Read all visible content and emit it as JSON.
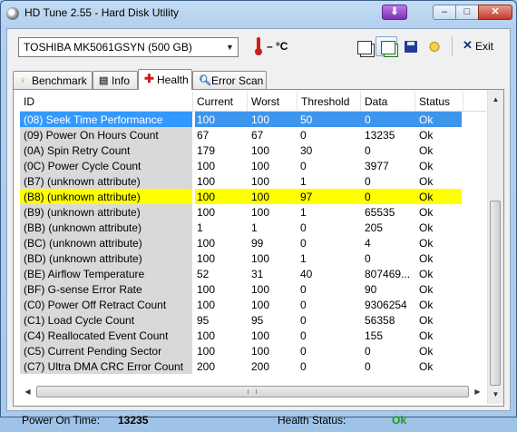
{
  "window": {
    "title": "HD Tune 2.55 - Hard Disk Utility"
  },
  "toolbar": {
    "drive": "TOSHIBA MK5061GSYN (500 GB)",
    "temperature": "– °C",
    "exit_label": "Exit"
  },
  "tabs": [
    {
      "label": "Benchmark"
    },
    {
      "label": "Info"
    },
    {
      "label": "Health"
    },
    {
      "label": "Error Scan"
    }
  ],
  "table": {
    "columns": [
      "ID",
      "Current",
      "Worst",
      "Threshold",
      "Data",
      "Status"
    ],
    "rows": [
      {
        "id": "(08) Seek Time Performance",
        "current": "100",
        "worst": "100",
        "threshold": "50",
        "data": "0",
        "status": "Ok"
      },
      {
        "id": "(09) Power On Hours Count",
        "current": "67",
        "worst": "67",
        "threshold": "0",
        "data": "13235",
        "status": "Ok"
      },
      {
        "id": "(0A) Spin Retry Count",
        "current": "179",
        "worst": "100",
        "threshold": "30",
        "data": "0",
        "status": "Ok"
      },
      {
        "id": "(0C) Power Cycle Count",
        "current": "100",
        "worst": "100",
        "threshold": "0",
        "data": "3977",
        "status": "Ok"
      },
      {
        "id": "(B7) (unknown attribute)",
        "current": "100",
        "worst": "100",
        "threshold": "1",
        "data": "0",
        "status": "Ok"
      },
      {
        "id": "(B8) (unknown attribute)",
        "current": "100",
        "worst": "100",
        "threshold": "97",
        "data": "0",
        "status": "Ok"
      },
      {
        "id": "(B9) (unknown attribute)",
        "current": "100",
        "worst": "100",
        "threshold": "1",
        "data": "65535",
        "status": "Ok"
      },
      {
        "id": "(BB) (unknown attribute)",
        "current": "1",
        "worst": "1",
        "threshold": "0",
        "data": "205",
        "status": "Ok"
      },
      {
        "id": "(BC) (unknown attribute)",
        "current": "100",
        "worst": "99",
        "threshold": "0",
        "data": "4",
        "status": "Ok"
      },
      {
        "id": "(BD) (unknown attribute)",
        "current": "100",
        "worst": "100",
        "threshold": "1",
        "data": "0",
        "status": "Ok"
      },
      {
        "id": "(BE) Airflow Temperature",
        "current": "52",
        "worst": "31",
        "threshold": "40",
        "data": "807469...",
        "status": "Ok"
      },
      {
        "id": "(BF) G-sense Error Rate",
        "current": "100",
        "worst": "100",
        "threshold": "0",
        "data": "90",
        "status": "Ok"
      },
      {
        "id": "(C0) Power Off Retract Count",
        "current": "100",
        "worst": "100",
        "threshold": "0",
        "data": "9306254",
        "status": "Ok"
      },
      {
        "id": "(C1) Load Cycle Count",
        "current": "95",
        "worst": "95",
        "threshold": "0",
        "data": "56358",
        "status": "Ok"
      },
      {
        "id": "(C4) Reallocated Event Count",
        "current": "100",
        "worst": "100",
        "threshold": "0",
        "data": "155",
        "status": "Ok"
      },
      {
        "id": "(C5) Current Pending Sector",
        "current": "100",
        "worst": "100",
        "threshold": "0",
        "data": "0",
        "status": "Ok"
      },
      {
        "id": "(C7) Ultra DMA CRC Error Count",
        "current": "200",
        "worst": "200",
        "threshold": "0",
        "data": "0",
        "status": "Ok"
      }
    ]
  },
  "footer": {
    "power_on_label": "Power On Time:",
    "power_on_value": "13235",
    "health_label": "Health Status:",
    "health_value": "Ok"
  },
  "colors": {
    "selected_row": "#3399ff",
    "warning_row": "#ffff00",
    "health_ok": "#1b9c1b"
  },
  "icons": {
    "temperature": "thermometer-icon",
    "copy": "copy-text-icon",
    "copy_screen": "copy-screen-icon",
    "save": "save-icon",
    "options": "options-icon",
    "exit": "exit-icon"
  }
}
